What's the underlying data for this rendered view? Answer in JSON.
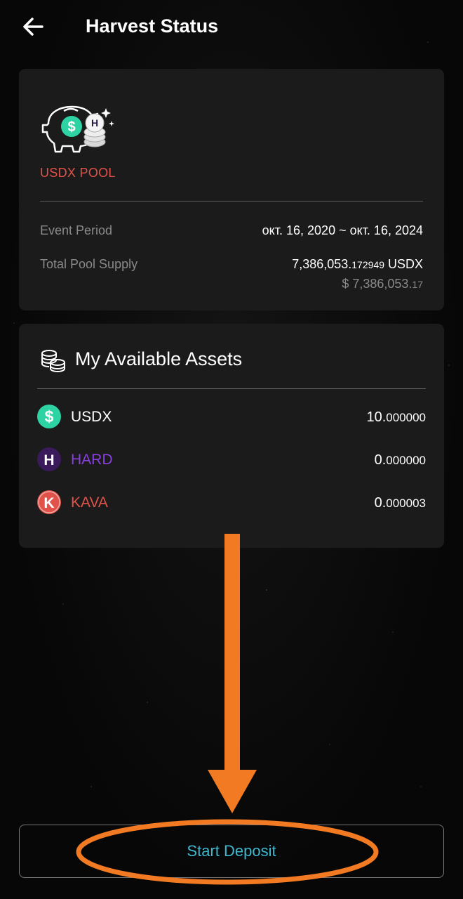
{
  "header": {
    "title": "Harvest Status",
    "back_icon": "arrow-left-icon"
  },
  "pool": {
    "logo_icon": "piggy-bank-coins-icon",
    "name": "USDX POOL",
    "event_period_label": "Event Period",
    "event_period_value": "окт. 16, 2020 ~ окт. 16, 2024",
    "total_supply_label": "Total Pool Supply",
    "total_supply_int": "7,386,053.",
    "total_supply_dec": "172949",
    "total_supply_unit": " USDX",
    "total_supply_usd_int": "$ 7,386,053.",
    "total_supply_usd_dec": "17"
  },
  "assets": {
    "title": "My Available Assets",
    "title_icon": "coins-stack-icon",
    "items": [
      {
        "name": "USDX",
        "icon": "usdx-token-icon",
        "icon_glyph": "$",
        "color": "#ffffff",
        "icon_color": "#2ed3a4",
        "amount_int": "10.",
        "amount_dec": "000000"
      },
      {
        "name": "HARD",
        "icon": "hard-token-icon",
        "icon_glyph": "H",
        "color": "#8a3fe0",
        "icon_color": "#3a1a5a",
        "amount_int": "0.",
        "amount_dec": "000000"
      },
      {
        "name": "KAVA",
        "icon": "kava-token-icon",
        "icon_glyph": "K",
        "color": "#e1534a",
        "icon_color": "#e1534a",
        "amount_int": "0.",
        "amount_dec": "000003"
      }
    ]
  },
  "actions": {
    "start_deposit": "Start Deposit"
  },
  "colors": {
    "accent_teal": "#3fb7cf",
    "pool_red": "#e1534a",
    "annotation_orange": "#f27a22"
  }
}
